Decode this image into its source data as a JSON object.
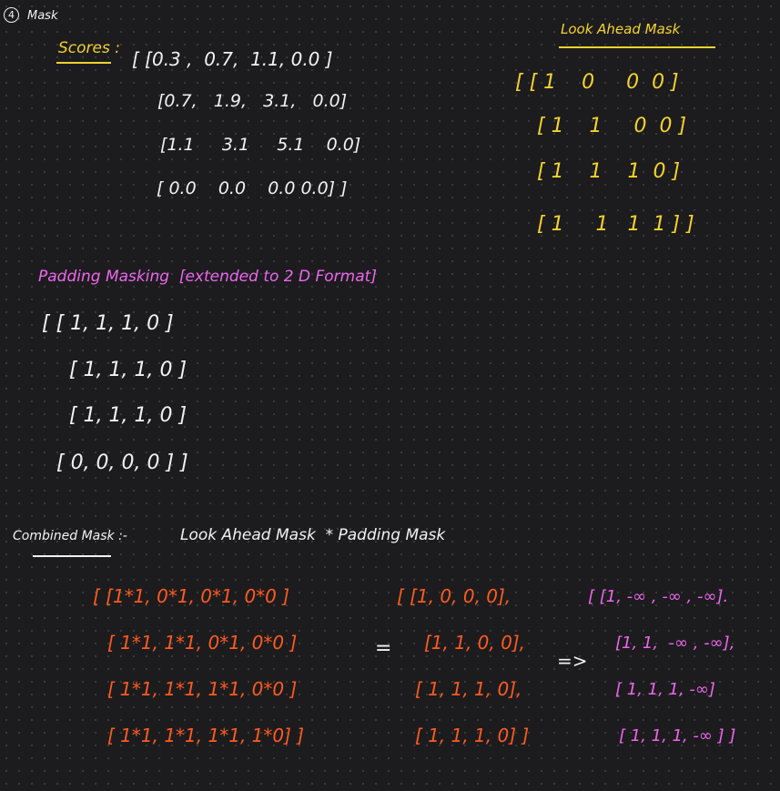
{
  "section": {
    "number": "4",
    "title": "Mask"
  },
  "scores": {
    "label": "Scores :",
    "rows": [
      "[ [0.3 ,  0.7,  1.1, 0.0 ]",
      "[0.7,   1.9,   3.1,   0.0]",
      "[1.1     3.1     5.1    0.0]",
      "[ 0.0    0.0    0.0 0.0] ]"
    ]
  },
  "look_ahead": {
    "title": "Look Ahead Mask",
    "rows": [
      "[ [ 1    0     0  0 ]",
      "[ 1    1     0  0 ]",
      "[ 1    1    1  0 ]",
      "[ 1     1   1  1 ] ]"
    ]
  },
  "padding": {
    "title": "Padding Masking  [extended to 2 D Format]",
    "rows": [
      "[ [ 1, 1, 1, 0 ]",
      "[ 1, 1, 1, 0 ]",
      "[ 1, 1, 1, 0 ]",
      "[ 0, 0, 0, 0 ] ]"
    ]
  },
  "combined": {
    "title": "Combined Mask :-",
    "formula": "Look Ahead Mask  * Padding Mask",
    "products": [
      "[ [1*1, 0*1, 0*1, 0*0 ]",
      "[ 1*1, 1*1, 0*1, 0*0 ]",
      "[ 1*1, 1*1, 1*1, 0*0 ]",
      "[ 1*1, 1*1, 1*1, 1*0] ]"
    ],
    "equals": "=",
    "results": [
      "[ [1, 0, 0, 0],",
      "[1, 1, 0, 0],",
      "[ 1, 1, 1, 0],",
      "[ 1, 1, 1, 0] ]"
    ],
    "implies": "=>",
    "final": [
      "[ [1, -∞ , -∞ , -∞].",
      "[1, 1,  -∞ , -∞],",
      "[ 1, 1, 1, -∞]",
      "[ 1, 1, 1, -∞ ] ]"
    ]
  },
  "colors": {
    "background": "#1c1c1e",
    "text": "#f2f2f2",
    "yellow": "#f5d22e",
    "pink": "#ee66ee",
    "orange": "#ff5a1f"
  }
}
